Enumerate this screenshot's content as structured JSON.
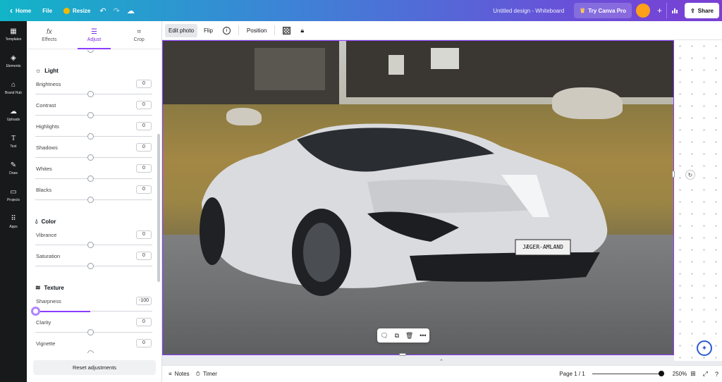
{
  "topbar": {
    "home": "Home",
    "file": "File",
    "resize": "Resize",
    "title": "Untitled design - Whiteboard",
    "try_pro": "Try Canva Pro",
    "share": "Share"
  },
  "rail": [
    {
      "icon": "templates-icon",
      "label": "Templates"
    },
    {
      "icon": "elements-icon",
      "label": "Elements"
    },
    {
      "icon": "brand-hub-icon",
      "label": "Brand Hub"
    },
    {
      "icon": "uploads-icon",
      "label": "Uploads"
    },
    {
      "icon": "text-icon",
      "label": "Text"
    },
    {
      "icon": "draw-icon",
      "label": "Draw"
    },
    {
      "icon": "projects-icon",
      "label": "Projects"
    },
    {
      "icon": "apps-icon",
      "label": "Apps"
    }
  ],
  "panel": {
    "tabs": [
      {
        "label": "Effects",
        "icon": "fx-icon"
      },
      {
        "label": "Adjust",
        "icon": "sliders-icon"
      },
      {
        "label": "Crop",
        "icon": "crop-icon"
      }
    ],
    "light": {
      "title": "Light",
      "rows": [
        {
          "label": "Brightness",
          "value": "0"
        },
        {
          "label": "Contrast",
          "value": "0"
        },
        {
          "label": "Highlights",
          "value": "0"
        },
        {
          "label": "Shadows",
          "value": "0"
        },
        {
          "label": "Whites",
          "value": "0"
        },
        {
          "label": "Blacks",
          "value": "0"
        }
      ]
    },
    "color": {
      "title": "Color",
      "rows": [
        {
          "label": "Vibrance",
          "value": "0"
        },
        {
          "label": "Saturation",
          "value": "0"
        }
      ]
    },
    "texture": {
      "title": "Texture",
      "rows": [
        {
          "label": "Sharpness",
          "value": "-100"
        },
        {
          "label": "Clarity",
          "value": "0"
        },
        {
          "label": "Vignette",
          "value": "0"
        }
      ]
    },
    "reset": "Reset adjustments"
  },
  "context_toolbar": {
    "edit_photo": "Edit photo",
    "flip": "Flip",
    "info": "i",
    "position": "Position"
  },
  "canvas": {
    "plate": "JÆGER-AMLAND"
  },
  "bottombar": {
    "notes": "Notes",
    "timer": "Timer",
    "page": "Page 1 / 1",
    "zoom": "250%"
  },
  "colors": {
    "accent": "#8b3dff"
  }
}
